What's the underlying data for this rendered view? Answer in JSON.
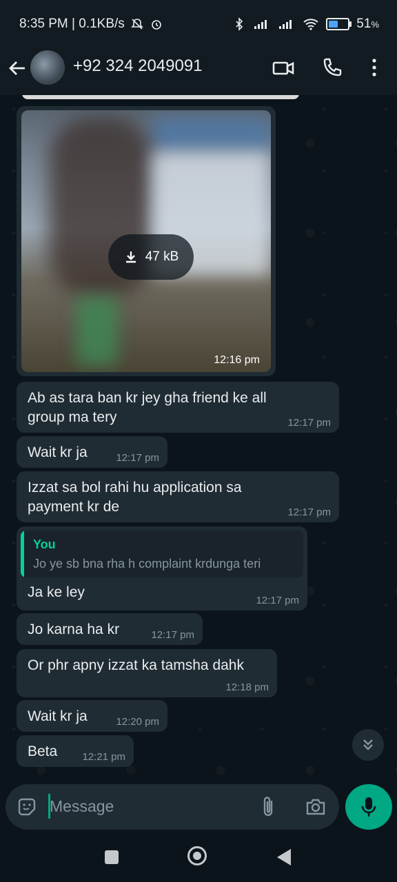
{
  "status_bar": {
    "time_speed": "8:35 PM | 0.1KB/s",
    "battery_text": "51",
    "battery_percent_sign": "%",
    "battery_level": 0.51
  },
  "header": {
    "contact": "+92 324 2049091",
    "icons": [
      "back-arrow-icon",
      "video-call-icon",
      "voice-call-icon",
      "more-options-icon"
    ]
  },
  "image_message": {
    "size": "47 kB",
    "time": "12:16 pm"
  },
  "messages": [
    {
      "text": "Ab as tara ban kr jey gha friend ke all\ngroup ma tery",
      "time": "12:17 pm"
    },
    {
      "text": "Wait kr ja",
      "time": "12:17 pm"
    },
    {
      "text": "Izzat sa bol rahi hu application sa\npayment kr de",
      "time": "12:17 pm"
    },
    {
      "quote_name": "You",
      "quote_text": "Jo ye sb bna rha h complaint krdunga teri",
      "text": "Ja ke ley",
      "time": "12:17 pm"
    },
    {
      "text": "Jo karna ha kr",
      "time": "12:17 pm"
    },
    {
      "text": "Or phr apny izzat ka tamsha dahk",
      "time": "12:18 pm"
    },
    {
      "text": "Wait kr ja",
      "time": "12:20 pm"
    },
    {
      "text": "Beta",
      "time": "12:21 pm"
    }
  ],
  "input": {
    "placeholder": "Message"
  },
  "colors": {
    "background": "#0b141a",
    "bubble": "#202c33",
    "accent": "#00a884",
    "quote_accent": "#06cf9c"
  }
}
